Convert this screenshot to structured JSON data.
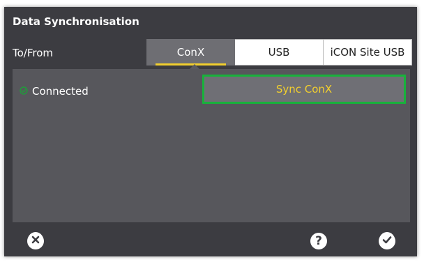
{
  "dialog": {
    "title": "Data Synchronisation",
    "to_from_label": "To/From",
    "tabs": [
      {
        "label": "ConX",
        "active": true
      },
      {
        "label": "USB",
        "active": false
      },
      {
        "label": "iCON Site USB",
        "active": false
      }
    ],
    "status": {
      "text": "Connected",
      "icon": "check-circle-icon",
      "color": "#1f9d3a"
    },
    "sync_button": {
      "label": "Sync ConX"
    },
    "footer": {
      "close_icon": "close-circle-icon",
      "help_label": "?",
      "confirm_icon": "check-circle-icon"
    }
  },
  "colors": {
    "background": "#3c3c41",
    "panel": "#57575c",
    "accent": "#f2cf2e",
    "highlight": "#18b23b"
  }
}
